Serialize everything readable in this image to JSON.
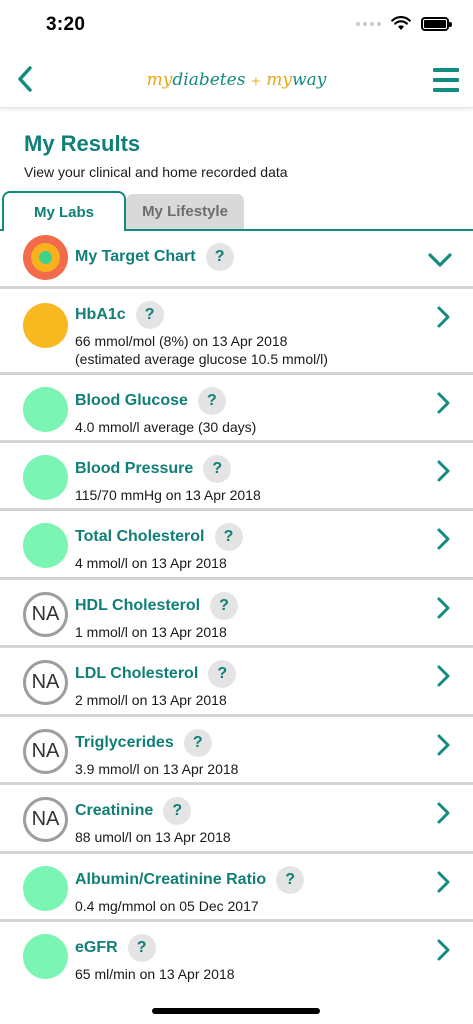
{
  "status_bar": {
    "time": "3:20"
  },
  "nav": {
    "logo_my": "my",
    "logo_diabetes": "diabetes",
    "logo_plus": "+",
    "logo_my2": "my",
    "logo_way": "way"
  },
  "page": {
    "title": "My Results",
    "subtitle": "View your clinical and home recorded data"
  },
  "tabs": [
    {
      "label": "My Labs",
      "active": true
    },
    {
      "label": "My Lifestyle",
      "active": false
    }
  ],
  "help_glyph": "?",
  "rows": [
    {
      "title": "My Target Chart",
      "indicator": "target",
      "line1": "",
      "line2": "",
      "chevron": "down"
    },
    {
      "title": "HbA1c",
      "indicator": "orange",
      "line1": "66 mmol/mol (8%) on 13 Apr 2018",
      "line2": "(estimated average glucose 10.5 mmol/l)",
      "chevron": "right"
    },
    {
      "title": "Blood Glucose",
      "indicator": "green",
      "line1": "4.0 mmol/l average (30 days)",
      "line2": "",
      "chevron": "right"
    },
    {
      "title": "Blood Pressure",
      "indicator": "green",
      "line1": "115/70 mmHg on 13 Apr 2018",
      "line2": "",
      "chevron": "right"
    },
    {
      "title": "Total Cholesterol",
      "indicator": "green",
      "line1": "4 mmol/l on 13 Apr 2018",
      "line2": "",
      "chevron": "right"
    },
    {
      "title": "HDL Cholesterol",
      "indicator": "na",
      "na_label": "NA",
      "line1": "1 mmol/l on 13 Apr 2018",
      "line2": "",
      "chevron": "right"
    },
    {
      "title": "LDL Cholesterol",
      "indicator": "na",
      "na_label": "NA",
      "line1": "2 mmol/l on 13 Apr 2018",
      "line2": "",
      "chevron": "right"
    },
    {
      "title": "Triglycerides",
      "indicator": "na",
      "na_label": "NA",
      "line1": "3.9 mmol/l on 13 Apr 2018",
      "line2": "",
      "chevron": "right"
    },
    {
      "title": "Creatinine",
      "indicator": "na",
      "na_label": "NA",
      "line1": "88 umol/l on 13 Apr 2018",
      "line2": "",
      "chevron": "right"
    },
    {
      "title": "Albumin/Creatinine Ratio",
      "indicator": "green",
      "line1": "0.4 mg/mmol on 05 Dec 2017",
      "line2": "",
      "chevron": "right"
    },
    {
      "title": "eGFR",
      "indicator": "green",
      "line1": "65 ml/min on 13 Apr 2018",
      "line2": "",
      "chevron": "right"
    }
  ],
  "colors": {
    "brand_teal": "#0f7f77",
    "status_green": "#7af5b3",
    "status_orange": "#f8b820",
    "na_grey": "#9e9e9e",
    "target_outer": "#f26b4a"
  }
}
